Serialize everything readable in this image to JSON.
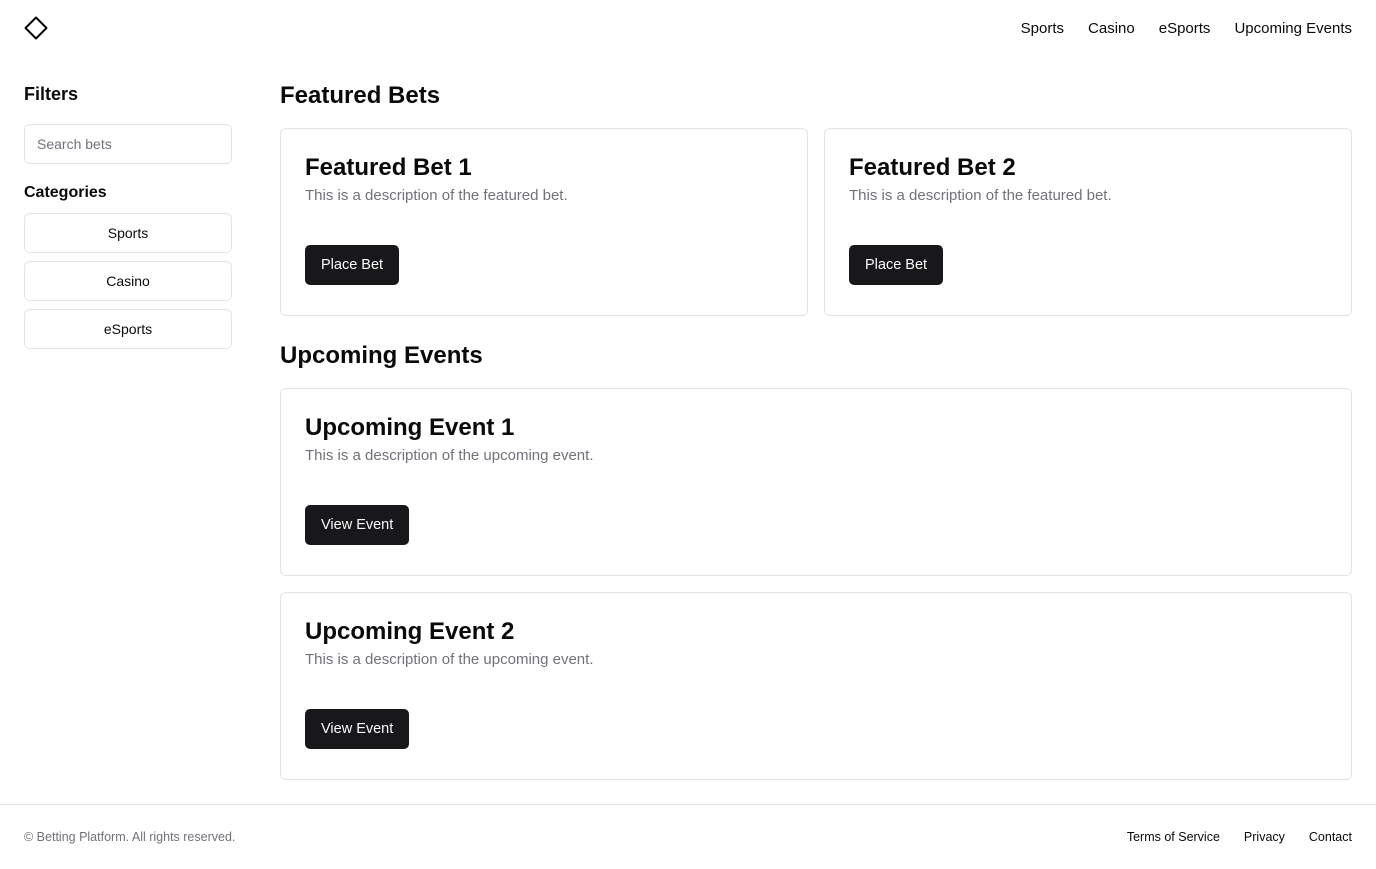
{
  "header": {
    "logo_icon": "diamond-icon",
    "nav": [
      {
        "label": "Sports"
      },
      {
        "label": "Casino"
      },
      {
        "label": "eSports"
      },
      {
        "label": "Upcoming Events"
      }
    ]
  },
  "sidebar": {
    "title": "Filters",
    "search_placeholder": "Search bets",
    "categories_title": "Categories",
    "categories": [
      {
        "label": "Sports"
      },
      {
        "label": "Casino"
      },
      {
        "label": "eSports"
      }
    ]
  },
  "featured": {
    "title": "Featured Bets",
    "cards": [
      {
        "title": "Featured Bet 1",
        "description": "This is a description of the featured bet.",
        "button": "Place Bet"
      },
      {
        "title": "Featured Bet 2",
        "description": "This is a description of the featured bet.",
        "button": "Place Bet"
      }
    ]
  },
  "events": {
    "title": "Upcoming Events",
    "cards": [
      {
        "title": "Upcoming Event 1",
        "description": "This is a description of the upcoming event.",
        "button": "View Event"
      },
      {
        "title": "Upcoming Event 2",
        "description": "This is a description of the upcoming event.",
        "button": "View Event"
      }
    ]
  },
  "footer": {
    "copyright": "© Betting Platform. All rights reserved.",
    "links": [
      {
        "label": "Terms of Service"
      },
      {
        "label": "Privacy"
      },
      {
        "label": "Contact"
      }
    ]
  },
  "colors": {
    "primary_button": "#18181b",
    "border": "#e4e4e7",
    "muted_text": "#71717a"
  }
}
